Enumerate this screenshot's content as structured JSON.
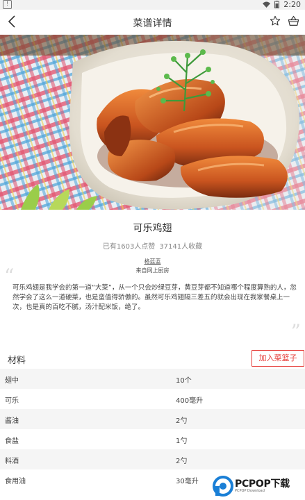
{
  "status_bar": {
    "time": "2:20"
  },
  "header": {
    "title": "菜谱详情"
  },
  "dish": {
    "name": "可乐鸡翅",
    "likes": "已有1603人点赞",
    "favorites": "37141人收藏",
    "author": "格蓝蓝",
    "source": "来自网上厨房"
  },
  "description": "可乐鸡翅是我学会的第一道“大菜”，从一个只会炒绿豆芽，黄豆芽都不知道哪个程度算熟的人，忽然学会了这么一道硬菜，也是蛮值得骄傲的。虽然可乐鸡翅隔三差五的就会出现在我家餐桌上一次，也是真的百吃不腻，汤汁配米饭，绝了。",
  "materials": {
    "title": "材料",
    "add_button": "加入菜篮子",
    "items": [
      {
        "name": "翅中",
        "amount": "10个"
      },
      {
        "name": "可乐",
        "amount": "400毫升"
      },
      {
        "name": "酱油",
        "amount": "2勺"
      },
      {
        "name": "食盐",
        "amount": "1勺"
      },
      {
        "name": "料酒",
        "amount": "2勺"
      },
      {
        "name": "食用油",
        "amount": "30毫升"
      }
    ]
  },
  "watermark": {
    "brand": "PCPOP下载",
    "sub": "PCPOP Download"
  },
  "colors": {
    "accent_red": "#e53935",
    "row_alt": "#f5f5f5"
  }
}
